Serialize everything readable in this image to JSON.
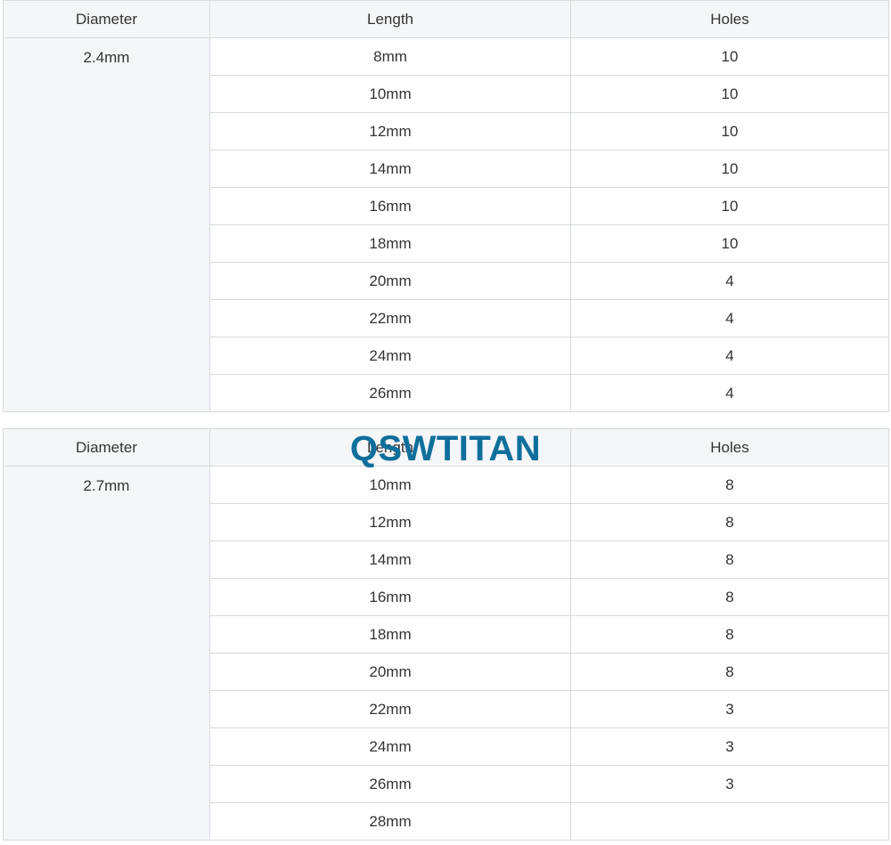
{
  "headers": {
    "diameter": "Diameter",
    "length": "Length",
    "holes": "Holes"
  },
  "watermark": {
    "text": "QSWTITAN",
    "color": "#0f6f9c"
  },
  "tables": [
    {
      "diameter": "2.4mm",
      "rows": [
        {
          "length": "8mm",
          "holes": "10"
        },
        {
          "length": "10mm",
          "holes": "10"
        },
        {
          "length": "12mm",
          "holes": "10"
        },
        {
          "length": "14mm",
          "holes": "10"
        },
        {
          "length": "16mm",
          "holes": "10"
        },
        {
          "length": "18mm",
          "holes": "10"
        },
        {
          "length": "20mm",
          "holes": "4"
        },
        {
          "length": "22mm",
          "holes": "4"
        },
        {
          "length": "24mm",
          "holes": "4"
        },
        {
          "length": "26mm",
          "holes": "4"
        }
      ]
    },
    {
      "diameter": "2.7mm",
      "rows": [
        {
          "length": "10mm",
          "holes": "8"
        },
        {
          "length": "12mm",
          "holes": "8"
        },
        {
          "length": "14mm",
          "holes": "8"
        },
        {
          "length": "16mm",
          "holes": "8"
        },
        {
          "length": "18mm",
          "holes": "8"
        },
        {
          "length": "20mm",
          "holes": "8"
        },
        {
          "length": "22mm",
          "holes": "3"
        },
        {
          "length": "24mm",
          "holes": "3"
        },
        {
          "length": "26mm",
          "holes": "3"
        },
        {
          "length": "28mm",
          "holes": ""
        }
      ]
    }
  ]
}
